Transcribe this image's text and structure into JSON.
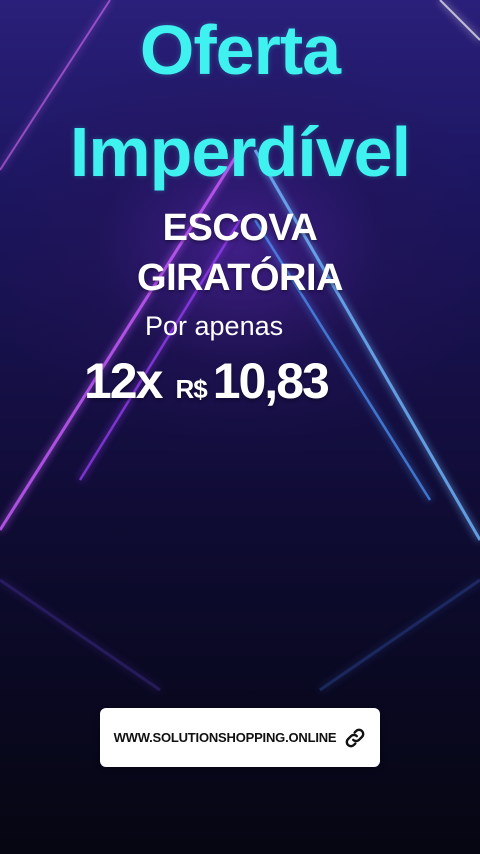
{
  "headline": {
    "line1": "Oferta",
    "line2": "Imperdível"
  },
  "product": {
    "line1": "ESCOVA",
    "line2": "GIRATÓRIA"
  },
  "price": {
    "prefix": "Por apenas",
    "installments": "12x",
    "currency": "R$",
    "amount": "10,83"
  },
  "link": {
    "url_text": "WWW.SOLUTIONSHOPPING.ONLINE",
    "icon": "link-icon"
  },
  "colors": {
    "headline": "#3ff2f0",
    "text": "#ffffff",
    "neon_pink": "#e04bff",
    "neon_blue": "#5aa8ff",
    "background_top": "#2a1f7a",
    "background_bottom": "#060612"
  }
}
